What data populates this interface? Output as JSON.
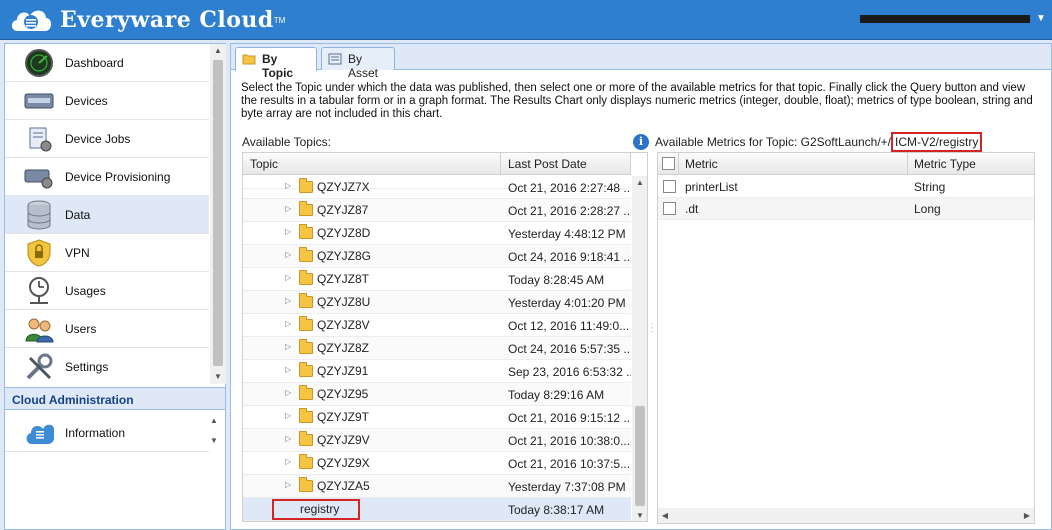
{
  "app": {
    "title": "Everyware Cloud",
    "tm": "TM"
  },
  "header": {
    "user_menu_caret": "▼"
  },
  "sidebar": {
    "items": [
      {
        "label": "Dashboard",
        "icon": "dashboard-icon",
        "active": false
      },
      {
        "label": "Devices",
        "icon": "devices-icon",
        "active": false
      },
      {
        "label": "Device Jobs",
        "icon": "device-jobs-icon",
        "active": false
      },
      {
        "label": "Device Provisioning",
        "icon": "device-provisioning-icon",
        "active": false
      },
      {
        "label": "Data",
        "icon": "data-icon",
        "active": true
      },
      {
        "label": "VPN",
        "icon": "vpn-icon",
        "active": false
      },
      {
        "label": "Usages",
        "icon": "usages-icon",
        "active": false
      },
      {
        "label": "Users",
        "icon": "users-icon",
        "active": false
      },
      {
        "label": "Settings",
        "icon": "settings-icon",
        "active": false
      }
    ],
    "section_title": "Cloud Administration",
    "admin_items": [
      {
        "label": "Information",
        "icon": "information-icon"
      }
    ]
  },
  "tabs": [
    {
      "label": "By Topic",
      "active": true
    },
    {
      "label": "By Asset",
      "active": false
    }
  ],
  "description": "Select the Topic under which the data was published, then select one or more of the available metrics for that topic. Finally click the Query button and view the results in a tabular form or in a graph format. The Results Chart only displays numeric metrics (integer, double, float); metrics of type boolean, string and byte array are not included in this chart.",
  "topics": {
    "label": "Available Topics:",
    "columns": {
      "topic": "Topic",
      "last_post": "Last Post Date"
    },
    "rows": [
      {
        "name": "QZYJZ7X",
        "date": "Oct 21, 2016 2:27:48 ..."
      },
      {
        "name": "QZYJZ87",
        "date": "Oct 21, 2016 2:28:27 ..."
      },
      {
        "name": "QZYJZ8D",
        "date": "Yesterday 4:48:12 PM"
      },
      {
        "name": "QZYJZ8G",
        "date": "Oct 24, 2016 9:18:41 ..."
      },
      {
        "name": "QZYJZ8T",
        "date": "Today 8:28:45 AM"
      },
      {
        "name": "QZYJZ8U",
        "date": "Yesterday 4:01:20 PM"
      },
      {
        "name": "QZYJZ8V",
        "date": "Oct 12, 2016 11:49:0..."
      },
      {
        "name": "QZYJZ8Z",
        "date": "Oct 24, 2016 5:57:35 ..."
      },
      {
        "name": "QZYJZ91",
        "date": "Sep 23, 2016 6:53:32 ..."
      },
      {
        "name": "QZYJZ95",
        "date": "Today 8:29:16 AM"
      },
      {
        "name": "QZYJZ9T",
        "date": "Oct 21, 2016 9:15:12 ..."
      },
      {
        "name": "QZYJZ9V",
        "date": "Oct 21, 2016 10:38:0..."
      },
      {
        "name": "QZYJZ9X",
        "date": "Oct 21, 2016 10:37:5..."
      },
      {
        "name": "QZYJZA5",
        "date": "Yesterday 7:37:08 PM"
      }
    ],
    "selected": {
      "name": "registry",
      "date": "Today 8:38:17 AM"
    }
  },
  "metrics": {
    "label_prefix": "Available Metrics for Topic: G2SoftLaunch/+/",
    "label_topic": "ICM-V2/registry",
    "columns": {
      "metric": "Metric",
      "type": "Metric Type"
    },
    "rows": [
      {
        "name": "printerList",
        "type": "String"
      },
      {
        "name": ".dt",
        "type": "Long"
      }
    ]
  },
  "colors": {
    "header_bg": "#2f7fd1",
    "highlight_border": "#d32525",
    "selected_row": "#dfe8f6"
  }
}
